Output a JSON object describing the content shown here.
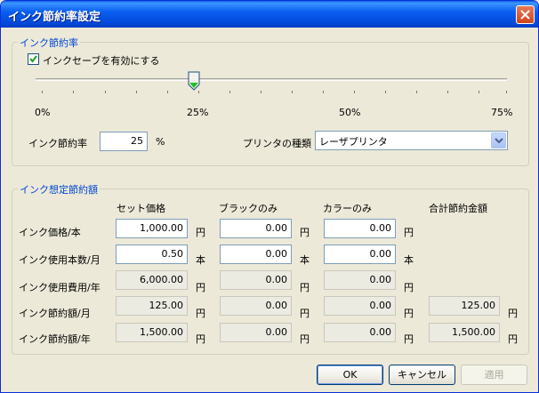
{
  "window": {
    "title": "インク節約率設定"
  },
  "ink_saving": {
    "group_title": "インク節約率",
    "checkbox_label": "インクセーブを有効にする",
    "checkbox_checked": true,
    "slider_value_percent": 25,
    "slider_ticks": [
      "0%",
      "25%",
      "50%",
      "75%"
    ],
    "rate_label": "インク節約率",
    "rate_value": "25",
    "rate_unit": "%",
    "printer_type_label": "プリンタの種類",
    "printer_type_value": "レーザプリンタ"
  },
  "estimate": {
    "group_title": "インク想定節約額",
    "columns": [
      "セット価格",
      "ブラックのみ",
      "カラーのみ",
      "合計節約金額"
    ],
    "rows": [
      {
        "label": "インク価格/本",
        "set": "1,000.00",
        "set_unit": "円",
        "black": "0.00",
        "black_unit": "円",
        "color": "0.00",
        "color_unit": "円"
      },
      {
        "label": "インク使用本数/月",
        "set": "0.50",
        "set_unit": "本",
        "black": "0.00",
        "black_unit": "本",
        "color": "0.00",
        "color_unit": "本"
      },
      {
        "label": "インク使用費用/年",
        "set": "6,000.00",
        "set_unit": "円",
        "black": "0.00",
        "black_unit": "円",
        "color": "0.00",
        "color_unit": "円"
      },
      {
        "label": "インク節約額/月",
        "set": "125.00",
        "set_unit": "円",
        "black": "0.00",
        "black_unit": "円",
        "color": "0.00",
        "color_unit": "円",
        "total": "125.00",
        "total_unit": "円"
      },
      {
        "label": "インク節約額/年",
        "set": "1,500.00",
        "set_unit": "円",
        "black": "0.00",
        "black_unit": "円",
        "color": "0.00",
        "color_unit": "円",
        "total": "1,500.00",
        "total_unit": "円"
      }
    ]
  },
  "buttons": {
    "ok": "OK",
    "cancel": "キャンセル",
    "apply": "適用"
  },
  "colors": {
    "group_title": "#0046d5",
    "titlebar": "#0a5fe8",
    "window_bg": "#ece9d8"
  }
}
